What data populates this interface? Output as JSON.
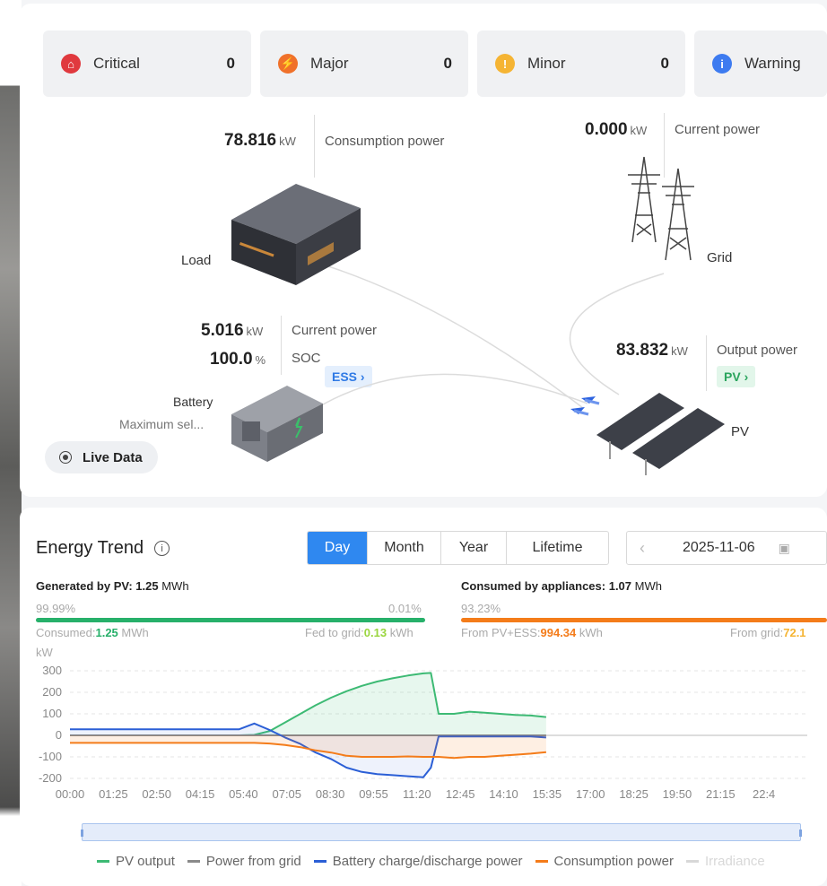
{
  "alarms": [
    {
      "label": "Critical",
      "count": "0",
      "color": "#e0393e",
      "icon": "critical-alarm-icon",
      "glyph": "⌂"
    },
    {
      "label": "Major",
      "count": "0",
      "color": "#f0712a",
      "icon": "major-alarm-icon",
      "glyph": "⚡"
    },
    {
      "label": "Minor",
      "count": "0",
      "color": "#f5b433",
      "icon": "minor-alarm-icon",
      "glyph": "!"
    },
    {
      "label": "Warning",
      "count": "",
      "color": "#3d7bf0",
      "icon": "warning-info-icon",
      "glyph": "i"
    }
  ],
  "flow": {
    "load": {
      "value": "78.816",
      "unit": "kW",
      "caption": "Consumption power",
      "name": "Load"
    },
    "grid": {
      "value": "0.000",
      "unit": "kW",
      "caption": "Current power",
      "name": "Grid"
    },
    "battery": {
      "power_value": "5.016",
      "power_unit": "kW",
      "power_caption": "Current power",
      "soc_value": "100.0",
      "soc_unit": "%",
      "soc_caption": "SOC",
      "ess_tag": "ESS ›",
      "name": "Battery",
      "mode": "Maximum sel..."
    },
    "pv": {
      "value": "83.832",
      "unit": "kW",
      "caption": "Output power",
      "pv_tag": "PV ›",
      "name": "PV"
    },
    "live_label": "Live Data"
  },
  "trend": {
    "title": "Energy Trend",
    "tabs": [
      "Day",
      "Month",
      "Year",
      "Lifetime"
    ],
    "active_tab": "Day",
    "date": "2025-11-06",
    "generated": {
      "label": "Generated by PV:",
      "value": "1.25",
      "unit": "MWh",
      "pct_left": "99.99%",
      "pct_right": "0.01%",
      "consumed_label": "Consumed:",
      "consumed_value": "1.25",
      "consumed_unit": "MWh",
      "fed_label": "Fed to grid:",
      "fed_value": "0.13",
      "fed_unit": "kWh"
    },
    "consumed": {
      "label": "Consumed by appliances:",
      "value": "1.07",
      "unit": "MWh",
      "pct_left": "93.23%",
      "from_pv_label": "From PV+ESS:",
      "from_pv_value": "994.34",
      "from_pv_unit": "kWh",
      "from_grid_label": "From grid:",
      "from_grid_value": "72.1"
    }
  },
  "chart_data": {
    "type": "line",
    "ylabel": "kW",
    "ylim": [
      -200,
      300
    ],
    "yticks": [
      300,
      200,
      100,
      0,
      -100,
      -200
    ],
    "xticks": [
      "00:00",
      "01:25",
      "02:50",
      "04:15",
      "05:40",
      "07:05",
      "08:30",
      "09:55",
      "11:20",
      "12:45",
      "14:10",
      "15:35",
      "17:00",
      "18:25",
      "19:50",
      "21:15",
      "22:4"
    ],
    "x_hours": [
      0,
      1,
      2,
      3,
      4,
      5,
      5.5,
      6,
      6.5,
      7,
      7.5,
      8,
      8.5,
      9,
      9.5,
      10,
      10.5,
      11,
      11.5,
      11.75,
      12,
      12.5,
      13,
      13.5,
      14,
      14.5,
      15,
      15.5
    ],
    "series": [
      {
        "name": "PV output",
        "color": "#3dba74",
        "values": [
          0,
          0,
          0,
          0,
          0,
          0,
          0,
          2,
          20,
          60,
          100,
          140,
          175,
          205,
          230,
          250,
          265,
          278,
          288,
          290,
          100,
          100,
          110,
          105,
          100,
          95,
          92,
          85
        ]
      },
      {
        "name": "Power from grid",
        "color": "#8a8a8a",
        "values": [
          0,
          0,
          0,
          0,
          0,
          0,
          0,
          0,
          0,
          0,
          0,
          0,
          0,
          0,
          0,
          0,
          0,
          0,
          0,
          0,
          0,
          0,
          0,
          0,
          0,
          0,
          0,
          0
        ]
      },
      {
        "name": "Battery charge/discharge power",
        "color": "#2b5fd6",
        "values": [
          28,
          28,
          28,
          28,
          28,
          28,
          28,
          55,
          25,
          -10,
          -40,
          -80,
          -110,
          -150,
          -170,
          -180,
          -185,
          -190,
          -195,
          -150,
          -5,
          -5,
          -5,
          -5,
          -5,
          -5,
          -5,
          -10
        ]
      },
      {
        "name": "Consumption power",
        "color": "#f47c1a",
        "values": [
          -35,
          -35,
          -35,
          -35,
          -35,
          -35,
          -35,
          -35,
          -38,
          -45,
          -55,
          -70,
          -80,
          -95,
          -100,
          -100,
          -100,
          -98,
          -100,
          -100,
          -100,
          -105,
          -100,
          -100,
          -95,
          -90,
          -85,
          -78
        ]
      },
      {
        "name": "Irradiance",
        "color": "#d8d8d8",
        "values": []
      }
    ]
  }
}
